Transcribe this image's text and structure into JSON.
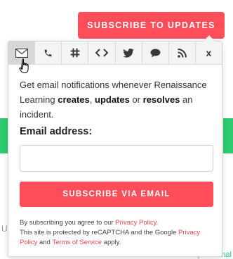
{
  "header": {
    "subscribe_button": "SUBSCRIBE TO UPDATES"
  },
  "background": {
    "left_fragment": "U",
    "right_fragment": "Operational"
  },
  "popup": {
    "tabs": [
      {
        "name": "email",
        "icon": "envelope-icon",
        "active": true
      },
      {
        "name": "sms",
        "icon": "phone-icon",
        "active": false
      },
      {
        "name": "slack",
        "icon": "slack-icon",
        "active": false
      },
      {
        "name": "webhook",
        "icon": "code-icon",
        "active": false
      },
      {
        "name": "twitter",
        "icon": "twitter-icon",
        "active": false
      },
      {
        "name": "support",
        "icon": "chat-bubble-icon",
        "active": false
      },
      {
        "name": "rss",
        "icon": "rss-icon",
        "active": false
      },
      {
        "name": "close",
        "icon": "close-icon",
        "label": "x",
        "active": false
      }
    ],
    "description": {
      "prefix": "Get email notifications whenever Renaissance Learning ",
      "w1": "creates",
      "sep1": ", ",
      "w2": "updates",
      "sep2": " or ",
      "w3": "resolves",
      "suffix": " an incident."
    },
    "email_label": "Email address:",
    "email_value": "",
    "email_placeholder": "",
    "submit_label": "SUBSCRIBE VIA EMAIL",
    "fine_print": {
      "t1": "By subscribing you agree to our ",
      "link1": "Privacy Policy",
      "t2": ".",
      "t3": "This site is protected by reCAPTCHA and the Google ",
      "link2": "Privacy Policy",
      "t4": " and ",
      "link3": "Terms of Service",
      "t5": " apply."
    }
  },
  "colors": {
    "accent": "#ff4d5a",
    "link": "#e8474f",
    "status_green": "#2ecc71"
  }
}
